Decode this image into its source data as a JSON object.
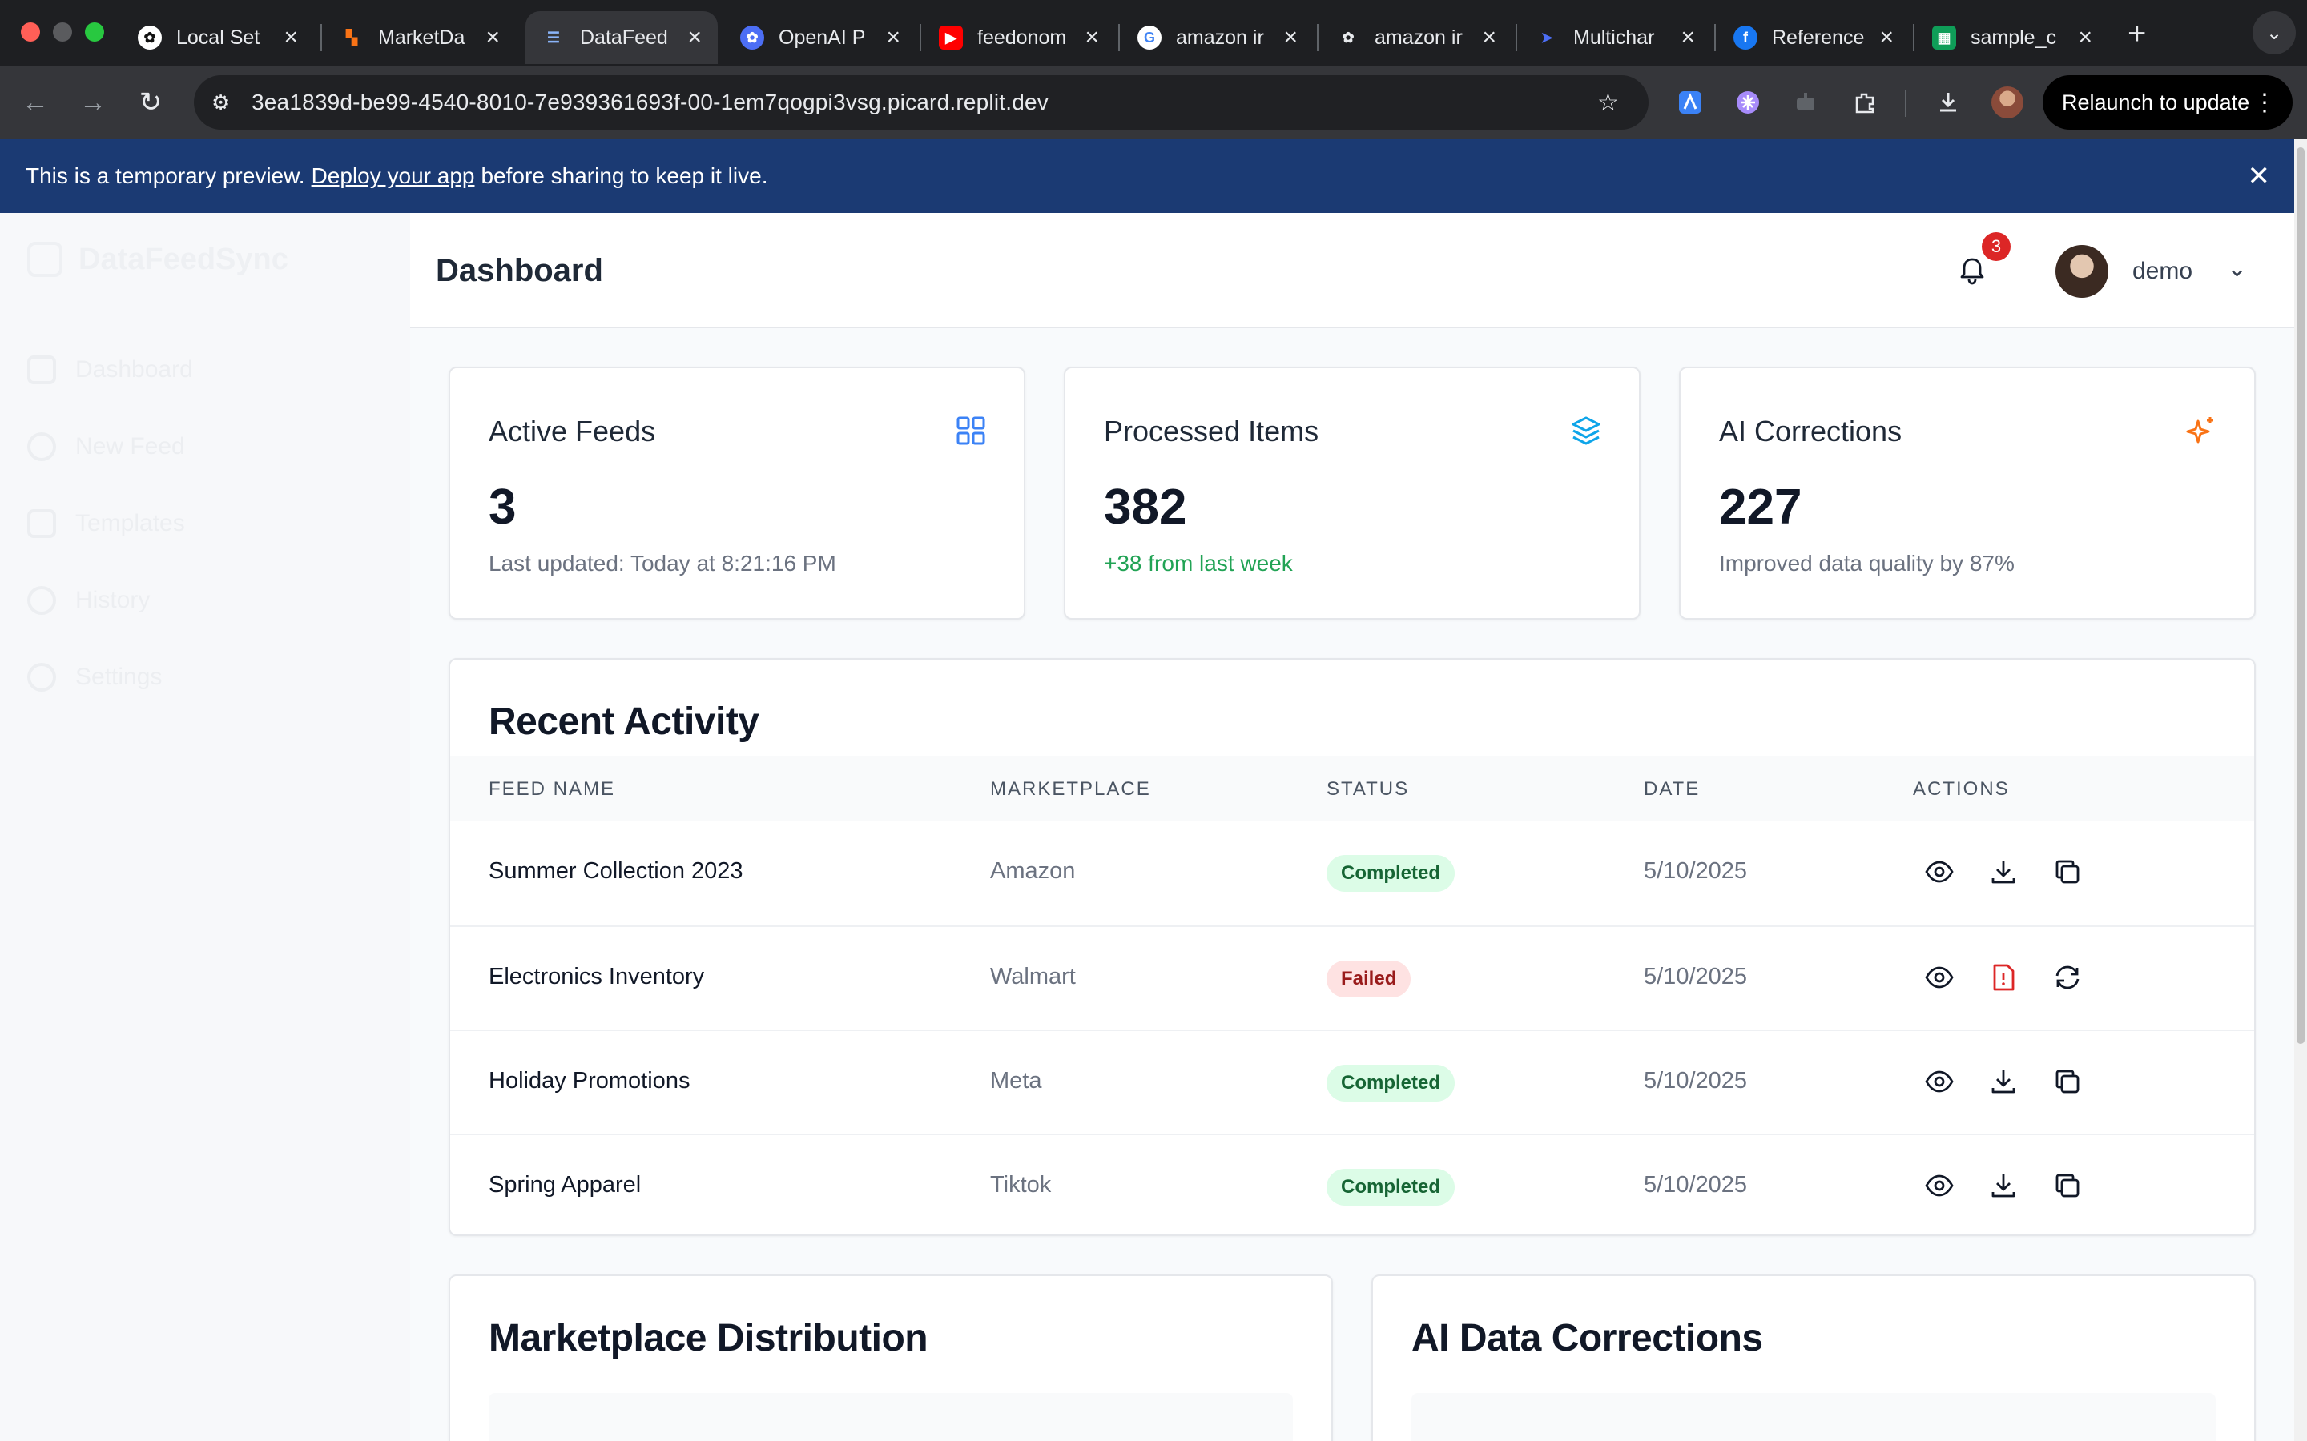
{
  "browser": {
    "tabs": [
      {
        "title": "Local Set",
        "icon": "openai-icon"
      },
      {
        "title": "MarketDa",
        "icon": "marketdata-icon"
      },
      {
        "title": "DataFeed",
        "icon": "list-icon"
      },
      {
        "title": "OpenAI P",
        "icon": "openai-icon"
      },
      {
        "title": "feedonom",
        "icon": "youtube-icon"
      },
      {
        "title": "amazon ir",
        "icon": "google-icon"
      },
      {
        "title": "amazon ir",
        "icon": "openai-icon"
      },
      {
        "title": "Multichar",
        "icon": "arrow-logo-icon"
      },
      {
        "title": "Reference",
        "icon": "facebook-icon"
      },
      {
        "title": "sample_c",
        "icon": "sheets-icon"
      }
    ],
    "url": "3ea1839d-be99-4540-8010-7e939361693f-00-1em7qogpi3vsg.picard.replit.dev",
    "relaunch_label": "Relaunch to update"
  },
  "banner": {
    "text_before": "This is a temporary preview.",
    "link": "Deploy your app",
    "text_after": "before sharing to keep it live."
  },
  "sidebar": {
    "brand": "DataFeedSync",
    "items": [
      {
        "label": "Dashboard"
      },
      {
        "label": "New Feed"
      },
      {
        "label": "Templates"
      },
      {
        "label": "History"
      },
      {
        "label": "Settings"
      }
    ]
  },
  "header": {
    "title": "Dashboard",
    "notification_count": "3",
    "user_name": "demo"
  },
  "stats": [
    {
      "label": "Active Feeds",
      "value": "3",
      "sub": "Last updated: Today at 8:21:16 PM",
      "icon": "grid-icon",
      "color": "#3b82f6"
    },
    {
      "label": "Processed Items",
      "value": "382",
      "sub": "+38 from last week",
      "icon": "layers-icon",
      "color": "#0ea5e9"
    },
    {
      "label": "AI Corrections",
      "value": "227",
      "sub": "Improved data quality by 87%",
      "icon": "sparkles-icon",
      "color": "#f97316"
    }
  ],
  "activity": {
    "title": "Recent Activity",
    "columns": [
      "FEED NAME",
      "MARKETPLACE",
      "STATUS",
      "DATE",
      "ACTIONS"
    ],
    "rows": [
      {
        "name": "Summer Collection 2023",
        "marketplace": "Amazon",
        "status": "Completed",
        "date": "5/10/2025"
      },
      {
        "name": "Electronics Inventory",
        "marketplace": "Walmart",
        "status": "Failed",
        "date": "5/10/2025"
      },
      {
        "name": "Holiday Promotions",
        "marketplace": "Meta",
        "status": "Completed",
        "date": "5/10/2025"
      },
      {
        "name": "Spring Apparel",
        "marketplace": "Tiktok",
        "status": "Completed",
        "date": "5/10/2025"
      }
    ]
  },
  "bottom": {
    "left_title": "Marketplace Distribution",
    "right_title": "AI Data Corrections"
  },
  "colors": {
    "banner": "#1b3a73",
    "success_bg": "#dcfce7",
    "success_text": "#166534",
    "fail_bg": "#fee2e2",
    "fail_text": "#991b1b",
    "badge": "#dc2626"
  }
}
